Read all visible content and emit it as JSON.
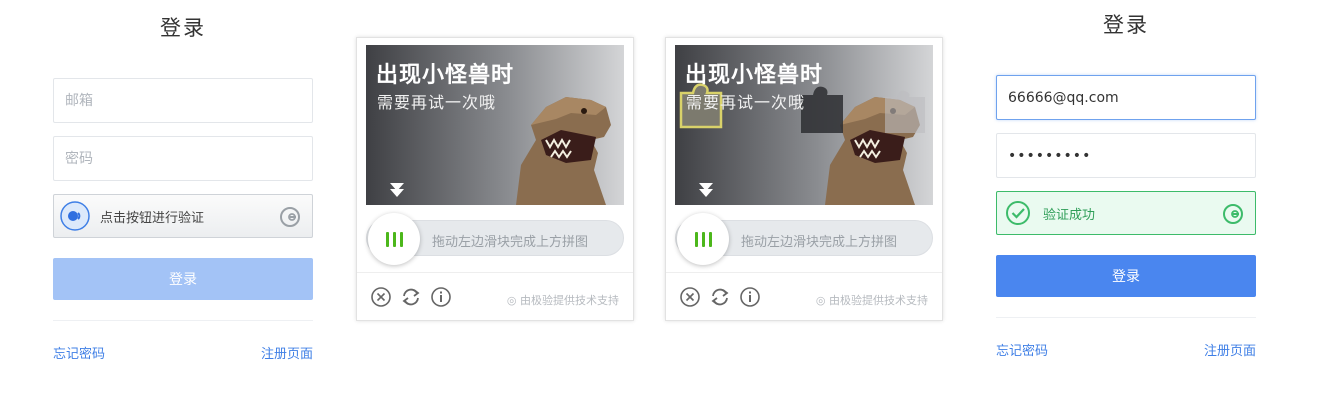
{
  "left_login": {
    "title": "登录",
    "email_placeholder": "邮箱",
    "password_placeholder": "密码",
    "verify_label": "点击按钮进行验证",
    "login_button": "登录",
    "forgot_link": "忘记密码",
    "register_link": "注册页面"
  },
  "captcha_1": {
    "headline": "出现小怪兽时",
    "subline": "需要再试一次哦",
    "slider_hint": "拖动左边滑块完成上方拼图",
    "brand": "由极验提供技术支持"
  },
  "captcha_2": {
    "headline": "出现小怪兽时",
    "subline": "需要再试一次哦",
    "slider_hint": "拖动左边滑块完成上方拼图",
    "brand": "由极验提供技术支持"
  },
  "right_login": {
    "title": "登录",
    "email_value": "66666@qq.com",
    "password_value": "•••••••••",
    "verify_success": "验证成功",
    "login_button": "登录",
    "forgot_link": "忘记密码",
    "register_link": "注册页面"
  },
  "colors": {
    "primary": "#4a86ef",
    "primary_disabled": "#a3c3f6",
    "link": "#3f7fe6",
    "success": "#3dbb6a",
    "slider_green": "#4cb71b"
  },
  "icons": {
    "close": "close-icon",
    "refresh": "refresh-icon",
    "info": "info-icon",
    "geetest": "geetest-logo-icon",
    "check": "check-circle-icon"
  }
}
